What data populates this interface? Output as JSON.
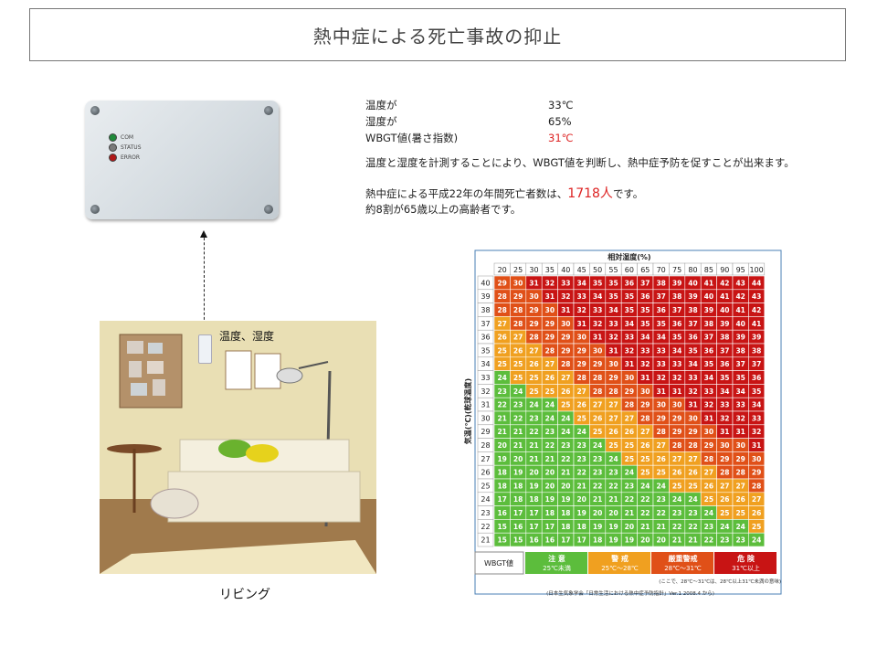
{
  "title": "熱中症による死亡事故の抑止",
  "device": {
    "leds": [
      "COM",
      "STATUS",
      "ERROR"
    ],
    "led_colors": [
      "#1f8a3a",
      "#7a7a7a",
      "#b01818"
    ]
  },
  "info": {
    "rows": [
      {
        "label": "温度が",
        "value": "33℃"
      },
      {
        "label": "湿度が",
        "value": "65%"
      },
      {
        "label": "WBGT値(暑さ指数)",
        "value": "31℃"
      }
    ],
    "desc": "温度と湿度を計測することにより、WBGT値を判断し、熱中症予防を促すことが出来ます。",
    "stat_prefix": "熱中症による平成22年の年間死亡者数は、",
    "stat_value": "1718人",
    "stat_suffix": "です。",
    "stat_line2": "約8割が65歳以上の高齢者です。"
  },
  "room": {
    "label": "温度、湿度",
    "caption": "リビング"
  },
  "chart_data": {
    "type": "heatmap",
    "title": "相対湿度(%)",
    "ylabel": "気温(℃)(乾球温度)",
    "humidity": [
      20,
      25,
      30,
      35,
      40,
      45,
      50,
      55,
      60,
      65,
      70,
      75,
      80,
      85,
      90,
      95,
      100
    ],
    "temperature": [
      40,
      39,
      38,
      37,
      36,
      35,
      34,
      33,
      32,
      31,
      30,
      29,
      28,
      27,
      26,
      25,
      24,
      23,
      22,
      21
    ],
    "values": [
      [
        29,
        30,
        31,
        32,
        33,
        34,
        35,
        35,
        36,
        37,
        38,
        39,
        40,
        41,
        42,
        43,
        44
      ],
      [
        28,
        29,
        30,
        31,
        32,
        33,
        34,
        35,
        35,
        36,
        37,
        38,
        39,
        40,
        41,
        42,
        43
      ],
      [
        28,
        28,
        29,
        30,
        31,
        32,
        33,
        34,
        35,
        35,
        36,
        37,
        38,
        39,
        40,
        41,
        42
      ],
      [
        27,
        28,
        29,
        29,
        30,
        31,
        32,
        33,
        34,
        35,
        35,
        36,
        37,
        38,
        39,
        40,
        41
      ],
      [
        26,
        27,
        28,
        29,
        29,
        30,
        31,
        32,
        33,
        34,
        34,
        35,
        36,
        37,
        38,
        39,
        39
      ],
      [
        25,
        26,
        27,
        28,
        29,
        29,
        30,
        31,
        32,
        33,
        33,
        34,
        35,
        36,
        37,
        38,
        38
      ],
      [
        25,
        25,
        26,
        27,
        28,
        29,
        29,
        30,
        31,
        32,
        33,
        33,
        34,
        35,
        36,
        37,
        37
      ],
      [
        24,
        25,
        25,
        26,
        27,
        28,
        28,
        29,
        30,
        31,
        32,
        32,
        33,
        34,
        35,
        35,
        36
      ],
      [
        23,
        24,
        25,
        25,
        26,
        27,
        28,
        28,
        29,
        30,
        31,
        31,
        32,
        33,
        34,
        34,
        35
      ],
      [
        22,
        23,
        24,
        24,
        25,
        26,
        27,
        27,
        28,
        29,
        30,
        30,
        31,
        32,
        33,
        33,
        34
      ],
      [
        21,
        22,
        23,
        24,
        24,
        25,
        26,
        27,
        27,
        28,
        29,
        29,
        30,
        31,
        32,
        32,
        33
      ],
      [
        21,
        21,
        22,
        23,
        24,
        24,
        25,
        26,
        26,
        27,
        28,
        29,
        29,
        30,
        31,
        31,
        32
      ],
      [
        20,
        21,
        21,
        22,
        23,
        23,
        24,
        25,
        25,
        26,
        27,
        28,
        28,
        29,
        30,
        30,
        31
      ],
      [
        19,
        20,
        21,
        21,
        22,
        23,
        23,
        24,
        25,
        25,
        26,
        27,
        27,
        28,
        29,
        29,
        30
      ],
      [
        18,
        19,
        20,
        20,
        21,
        22,
        23,
        23,
        24,
        25,
        25,
        26,
        26,
        27,
        28,
        28,
        29
      ],
      [
        18,
        18,
        19,
        20,
        20,
        21,
        22,
        22,
        23,
        24,
        24,
        25,
        25,
        26,
        27,
        27,
        28
      ],
      [
        17,
        18,
        18,
        19,
        19,
        20,
        21,
        21,
        22,
        22,
        23,
        24,
        24,
        25,
        26,
        26,
        27
      ],
      [
        16,
        17,
        17,
        18,
        18,
        19,
        20,
        20,
        21,
        22,
        22,
        23,
        23,
        24,
        25,
        25,
        26
      ],
      [
        15,
        16,
        17,
        17,
        18,
        18,
        19,
        19,
        20,
        21,
        21,
        22,
        22,
        23,
        24,
        24,
        25
      ],
      [
        15,
        15,
        16,
        16,
        17,
        17,
        18,
        19,
        19,
        20,
        20,
        21,
        21,
        22,
        23,
        23,
        24
      ]
    ],
    "legend": [
      {
        "name": "注 意",
        "range": "25℃未満",
        "color": "#5cbd3c"
      },
      {
        "name": "警 戒",
        "range": "25℃～28℃",
        "color": "#f0a020"
      },
      {
        "name": "厳重警戒",
        "range": "28℃～31℃",
        "color": "#e05018"
      },
      {
        "name": "危 険",
        "range": "31℃以上",
        "color": "#c81414"
      }
    ],
    "legend_label": "WBGT値",
    "note": "(ここで、28℃～31℃は、28℃以上31℃未満の意味)",
    "source": "(日本生気象学会「日常生活における熱中症予防指針」Ver.1 2008.4 から)"
  }
}
